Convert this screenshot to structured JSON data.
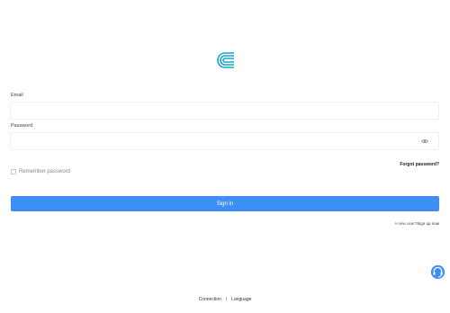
{
  "logo": {
    "icon": "brand-c-logo-icon",
    "color": "#1aa6c8"
  },
  "login": {
    "email_label": "Email",
    "email_value": "",
    "password_label": "Password",
    "password_value": "",
    "password_toggle_icon": "eye-icon",
    "forgot_password": "Forgot password?",
    "remember_label": "Remember password",
    "remember_checked": false,
    "signin_label": "Sign in",
    "signin_color": "#3d8ef5",
    "new_user_text": "A new user?",
    "signup_link": "Sign up now"
  },
  "support": {
    "icon": "customer-support-icon",
    "color": "#3d8ef5"
  },
  "footer": {
    "connection": "Connection",
    "separator": "|",
    "language": "Language"
  }
}
